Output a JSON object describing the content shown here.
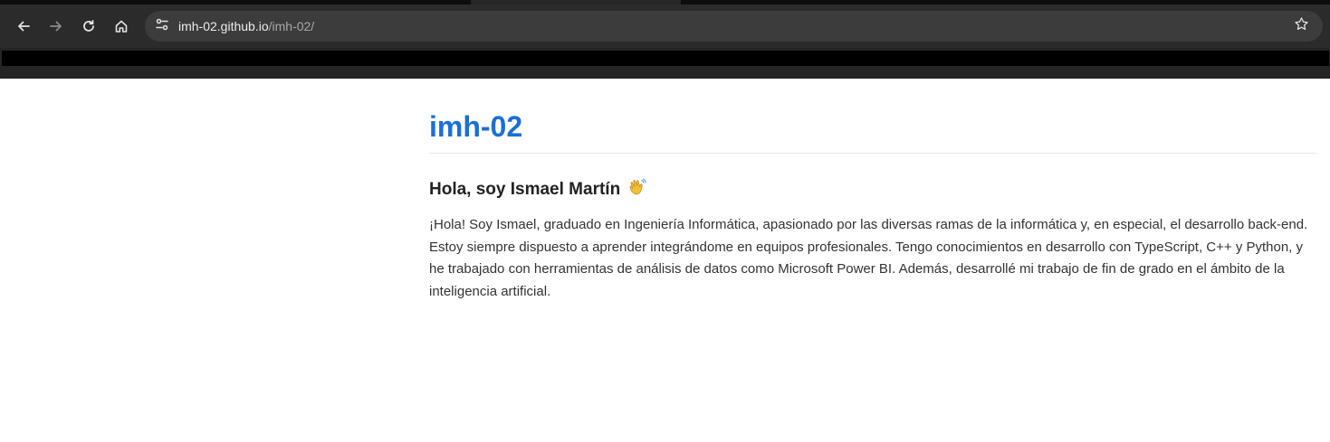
{
  "browser": {
    "url_host": "imh-02.github.io",
    "url_path": "/imh-02/",
    "icons": {
      "back": "arrow-left-icon",
      "forward": "arrow-right-icon",
      "reload": "reload-icon",
      "home": "home-icon",
      "site_info": "tune-icon",
      "bookmark": "star-icon"
    }
  },
  "page": {
    "site_title": "imh-02",
    "intro_heading": "Hola, soy Ismael Martín",
    "intro_emoji": "waving-hand-icon",
    "intro_text": "¡Hola! Soy Ismael, graduado en Ingeniería Informática, apasionado por las diversas ramas de la informática y, en especial, el desarrollo back-end. Estoy siempre dispuesto a aprender integrándome en equipos profesionales. Tengo conocimientos en desarrollo con TypeScript, C++ y Python, y he trabajado con herramientas de análisis de datos como Microsoft Power BI. Además, desarrollé mi trabajo de fin de grado en el ámbito de la inteligencia artificial."
  },
  "colors": {
    "title_blue": "#1a6fd6",
    "chrome_dark": "#2b2b2b",
    "omnibox_bg": "#3c3c3c"
  }
}
